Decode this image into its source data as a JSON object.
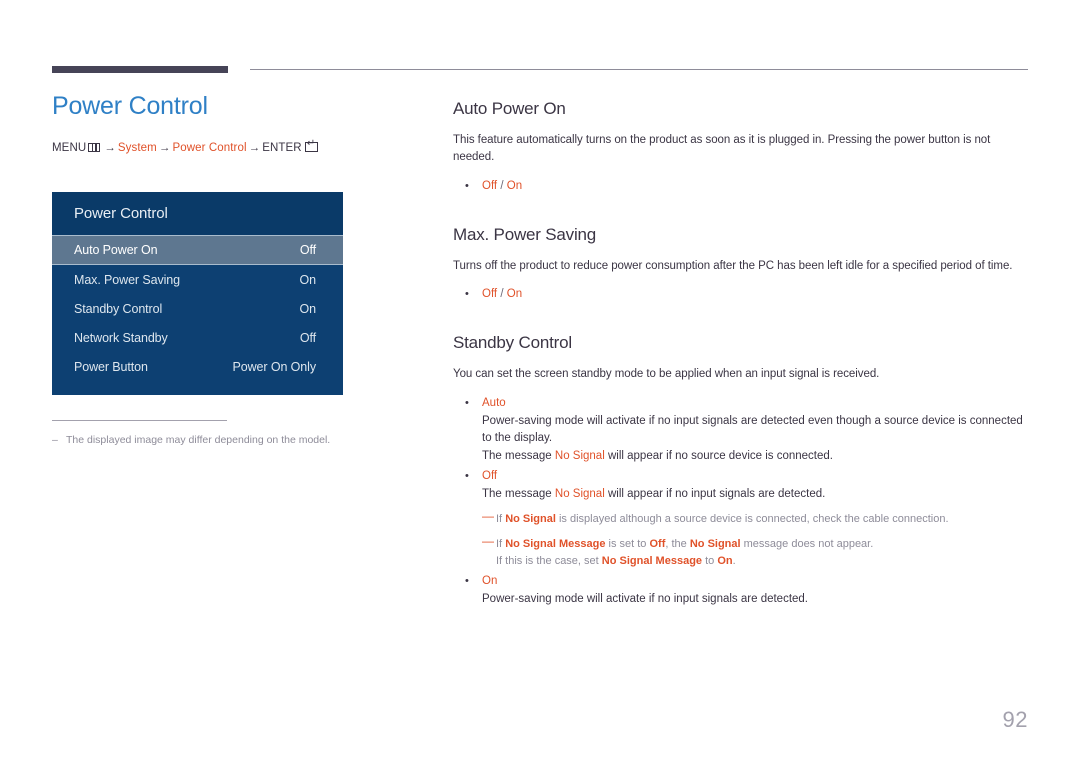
{
  "header": {
    "rule_color": "#464457",
    "thin_rule_color": "#8e8c99"
  },
  "left": {
    "page_title": "Power Control",
    "breadcrumb": {
      "menu_label": "MENU",
      "menu_icon": "menu-grid-icon",
      "arrow": "→",
      "crumb1": "System",
      "crumb2": "Power Control",
      "enter_label": "ENTER",
      "enter_icon": "enter-key-icon"
    },
    "osd": {
      "title": "Power Control",
      "rows": [
        {
          "label": "Auto Power On",
          "value": "Off",
          "highlight": true
        },
        {
          "label": "Max. Power Saving",
          "value": "On",
          "highlight": false
        },
        {
          "label": "Standby Control",
          "value": "On",
          "highlight": false
        },
        {
          "label": "Network Standby",
          "value": "Off",
          "highlight": false
        },
        {
          "label": "Power Button",
          "value": "Power On Only",
          "highlight": false
        }
      ]
    },
    "footnote": {
      "dash": "–",
      "text": "The displayed image may differ depending on the model."
    }
  },
  "right": {
    "sections": [
      {
        "heading": "Auto Power On",
        "desc": "This feature automatically turns on the product as soon as it is plugged in. Pressing the power button is not needed.",
        "option_off": "Off",
        "option_sep": "/",
        "option_on": "On"
      },
      {
        "heading": "Max. Power Saving",
        "desc": "Turns off the product to reduce power consumption after the PC has been left idle for a specified period of time.",
        "option_off": "Off",
        "option_sep": "/",
        "option_on": "On"
      }
    ],
    "standby": {
      "heading": "Standby Control",
      "desc": "You can set the screen standby mode to be applied when an input signal is received.",
      "auto": {
        "title": "Auto",
        "body": "Power-saving mode will activate if no input signals are detected even though a source device is connected to the display.",
        "msg_pre": "The message",
        "msg_kw": "No Signal",
        "msg_post": "will appear if no source device is connected."
      },
      "off": {
        "title": "Off",
        "msg_pre": "The message",
        "msg_kw": "No Signal",
        "msg_post": "will appear if no input signals are detected."
      },
      "notes": [
        {
          "dash": "—",
          "pre": "If",
          "kw1": "No Signal",
          "post": "is displayed although a source device is connected, check the cable connection."
        },
        {
          "dash": "—",
          "pre": "If",
          "kw1": "No Signal Message",
          "mid1": "is set to",
          "kw2": "Off",
          "mid2": ", the",
          "kw3": "No Signal",
          "post": "message does not appear.",
          "cont_pre": "If this is the case, set",
          "cont_kw": "No Signal Message",
          "cont_mid": "to",
          "cont_kw2": "On",
          "cont_post": "."
        }
      ],
      "on": {
        "title": "On",
        "body": "Power-saving mode will activate if no input signals are detected."
      }
    }
  },
  "footer": {
    "page_number": "92"
  }
}
